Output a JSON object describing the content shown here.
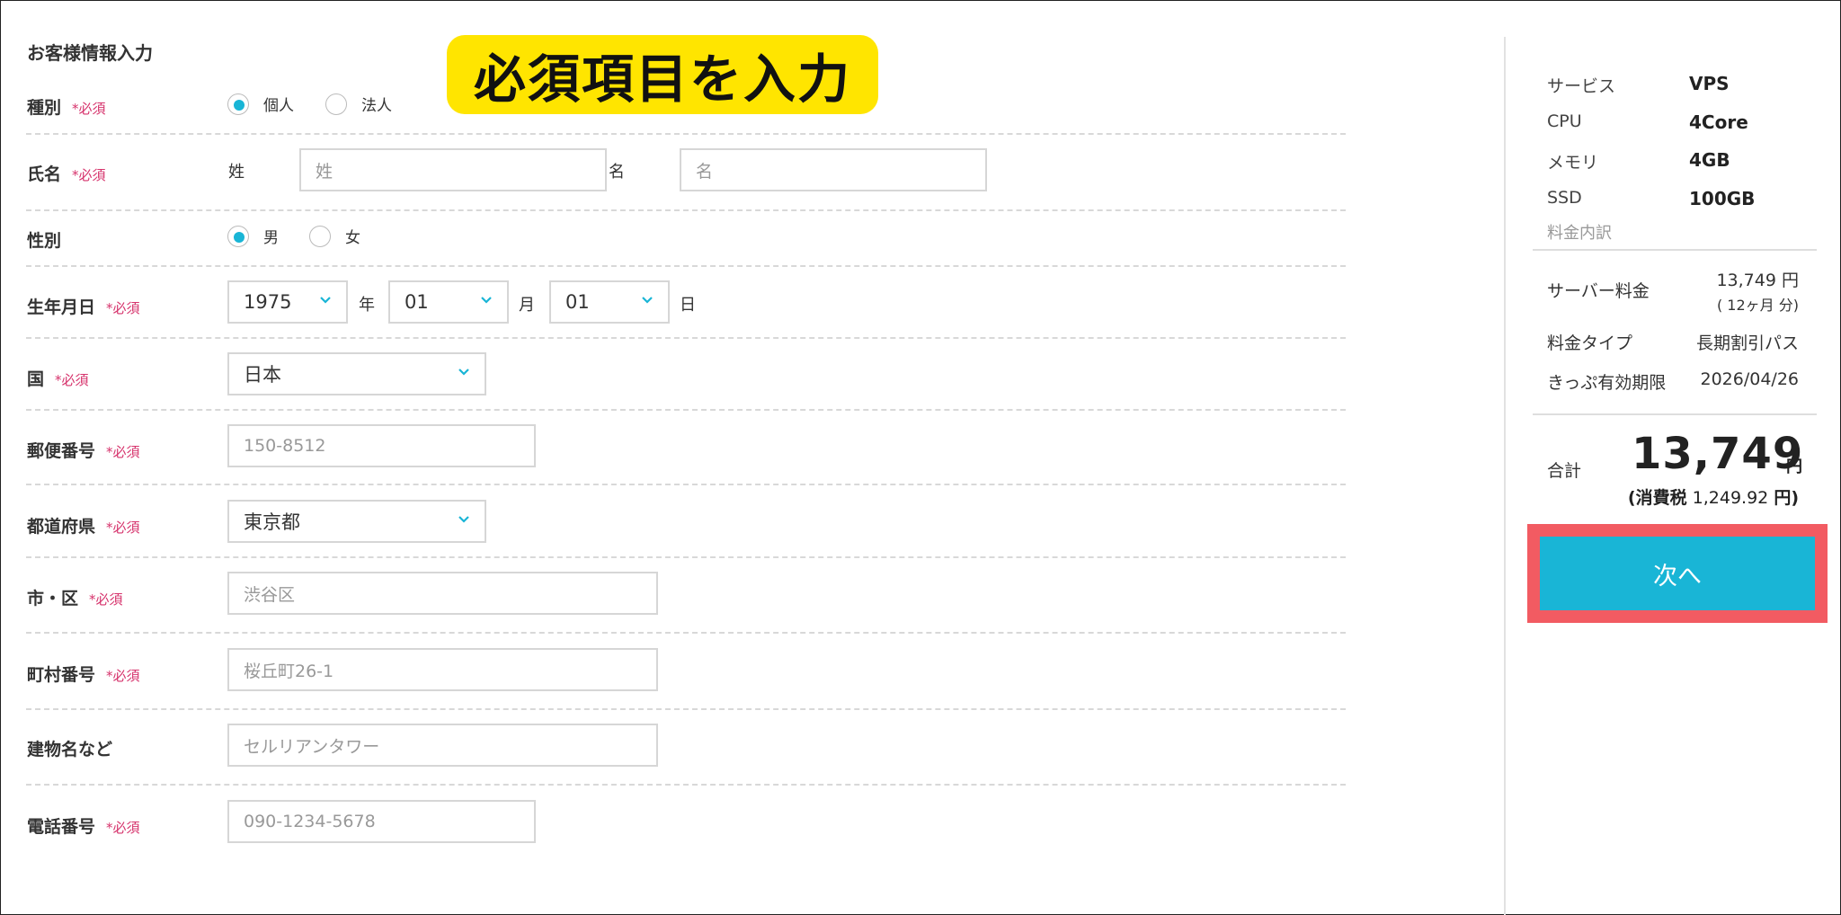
{
  "form": {
    "title": "お客様情報入力",
    "required_mark": "*必須",
    "banner": "必須項目を入力",
    "type": {
      "label": "種別",
      "options": [
        "個人",
        "法人"
      ],
      "selected": "個人"
    },
    "name": {
      "label": "氏名",
      "last_label": "姓",
      "last_placeholder": "姓",
      "first_label": "名",
      "first_placeholder": "名"
    },
    "gender": {
      "label": "性別",
      "options": [
        "男",
        "女"
      ],
      "selected": "男"
    },
    "birth": {
      "label": "生年月日",
      "year": "1975",
      "year_unit": "年",
      "month": "01",
      "month_unit": "月",
      "day": "01",
      "day_unit": "日"
    },
    "country": {
      "label": "国",
      "value": "日本"
    },
    "postal": {
      "label": "郵便番号",
      "placeholder": "150-8512"
    },
    "prefecture": {
      "label": "都道府県",
      "value": "東京都"
    },
    "city": {
      "label": "市・区",
      "placeholder": "渋谷区"
    },
    "town": {
      "label": "町村番号",
      "placeholder": "桜丘町26-1"
    },
    "building": {
      "label": "建物名など",
      "placeholder": "セルリアンタワー"
    },
    "phone": {
      "label": "電話番号",
      "placeholder": "090-1234-5678"
    }
  },
  "sidebar": {
    "specs": [
      {
        "key": "サービス",
        "value": "VPS"
      },
      {
        "key": "CPU",
        "value": "4Core"
      },
      {
        "key": "メモリ",
        "value": "4GB"
      },
      {
        "key": "SSD",
        "value": "100GB"
      }
    ],
    "breakdown_label": "料金内訳",
    "server_fee": {
      "key": "サーバー料金",
      "value": "13,749 円",
      "sub": "( 12ヶ月 分)"
    },
    "plan_type": {
      "key": "料金タイプ",
      "value": "長期割引パス"
    },
    "ticket_expiry": {
      "key": "きっぷ有効期限",
      "value": "2026/04/26"
    },
    "total": {
      "key": "合計",
      "value": "13,749",
      "unit": "円"
    },
    "tax": {
      "prefix": "(消費税",
      "amount": "1,249.92",
      "suffix": "円)"
    },
    "next_label": "次へ"
  },
  "colors": {
    "accent": "#19b5d6",
    "required": "#d6336c",
    "banner": "#ffe500",
    "cta_outline": "#f25b62"
  },
  "icons": {
    "select_arrow": "chevron-down-icon"
  }
}
